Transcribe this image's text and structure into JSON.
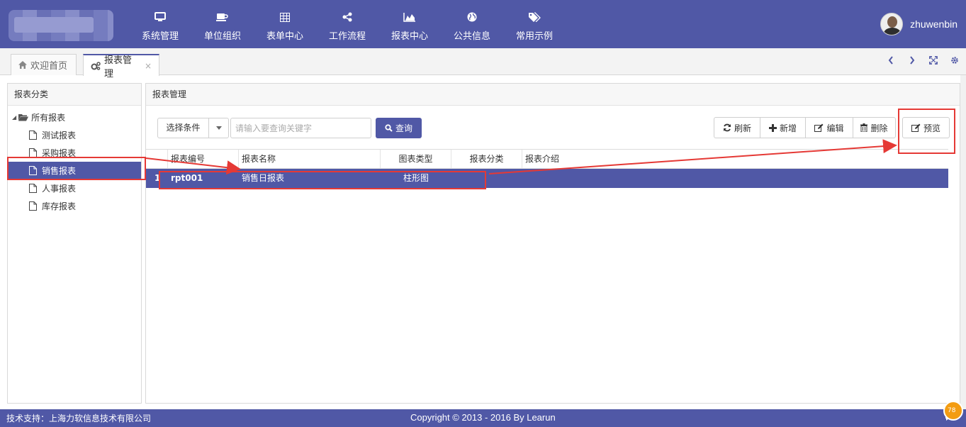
{
  "nav": {
    "items": [
      {
        "label": "系统管理",
        "icon": "monitor-icon"
      },
      {
        "label": "单位组织",
        "icon": "coffee-icon"
      },
      {
        "label": "表单中心",
        "icon": "table-icon"
      },
      {
        "label": "工作流程",
        "icon": "share-icon"
      },
      {
        "label": "报表中心",
        "icon": "area-chart-icon"
      },
      {
        "label": "公共信息",
        "icon": "globe-icon"
      },
      {
        "label": "常用示例",
        "icon": "tags-icon"
      }
    ],
    "username": "zhuwenbin"
  },
  "tabs": [
    {
      "label": "欢迎首页",
      "icon": "home-icon"
    },
    {
      "label": "报表管理",
      "icon": "cogs-icon",
      "close": "×"
    }
  ],
  "left": {
    "title": "报表分类",
    "root": "所有报表",
    "children": [
      "测试报表",
      "采购报表",
      "销售报表",
      "人事报表",
      "库存报表"
    ]
  },
  "right": {
    "title": "报表管理",
    "condition_label": "选择条件",
    "keyword_placeholder": "请输入要查询关键字",
    "query_label": "查询",
    "buttons": {
      "refresh": "刷新",
      "add": "新增",
      "edit": "编辑",
      "delete": "删除",
      "preview": "预览"
    }
  },
  "grid": {
    "columns": [
      "报表编号",
      "报表名称",
      "图表类型",
      "报表分类",
      "报表介绍"
    ],
    "rows": [
      {
        "index": "1",
        "code": "rpt001",
        "name": "销售日报表",
        "chart_type": "柱形图",
        "category": "",
        "intro": ""
      }
    ]
  },
  "footer": {
    "left": "技术支持：上海力软信息技术有限公司",
    "center": "Copyright © 2013 - 2016 By Learun",
    "badge": "78"
  },
  "colors": {
    "primary": "#5058a6",
    "annotation": "#e53935"
  }
}
